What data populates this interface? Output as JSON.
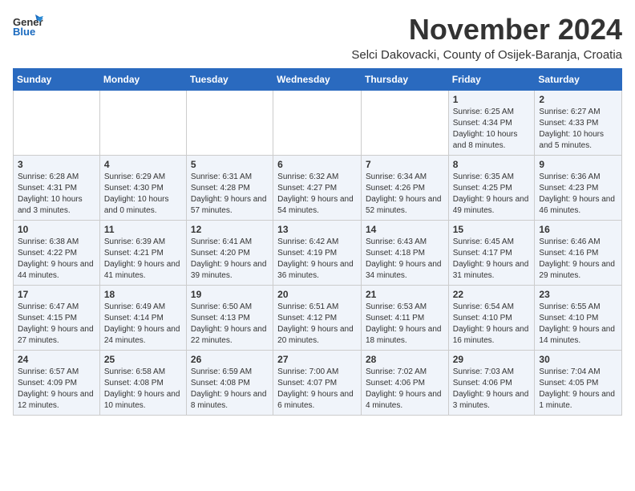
{
  "header": {
    "logo_general": "General",
    "logo_blue": "Blue",
    "month_title": "November 2024",
    "subtitle": "Selci Dakovacki, County of Osijek-Baranja, Croatia"
  },
  "weekdays": [
    "Sunday",
    "Monday",
    "Tuesday",
    "Wednesday",
    "Thursday",
    "Friday",
    "Saturday"
  ],
  "weeks": [
    [
      {
        "day": "",
        "info": ""
      },
      {
        "day": "",
        "info": ""
      },
      {
        "day": "",
        "info": ""
      },
      {
        "day": "",
        "info": ""
      },
      {
        "day": "",
        "info": ""
      },
      {
        "day": "1",
        "info": "Sunrise: 6:25 AM\nSunset: 4:34 PM\nDaylight: 10 hours and 8 minutes."
      },
      {
        "day": "2",
        "info": "Sunrise: 6:27 AM\nSunset: 4:33 PM\nDaylight: 10 hours and 5 minutes."
      }
    ],
    [
      {
        "day": "3",
        "info": "Sunrise: 6:28 AM\nSunset: 4:31 PM\nDaylight: 10 hours and 3 minutes."
      },
      {
        "day": "4",
        "info": "Sunrise: 6:29 AM\nSunset: 4:30 PM\nDaylight: 10 hours and 0 minutes."
      },
      {
        "day": "5",
        "info": "Sunrise: 6:31 AM\nSunset: 4:28 PM\nDaylight: 9 hours and 57 minutes."
      },
      {
        "day": "6",
        "info": "Sunrise: 6:32 AM\nSunset: 4:27 PM\nDaylight: 9 hours and 54 minutes."
      },
      {
        "day": "7",
        "info": "Sunrise: 6:34 AM\nSunset: 4:26 PM\nDaylight: 9 hours and 52 minutes."
      },
      {
        "day": "8",
        "info": "Sunrise: 6:35 AM\nSunset: 4:25 PM\nDaylight: 9 hours and 49 minutes."
      },
      {
        "day": "9",
        "info": "Sunrise: 6:36 AM\nSunset: 4:23 PM\nDaylight: 9 hours and 46 minutes."
      }
    ],
    [
      {
        "day": "10",
        "info": "Sunrise: 6:38 AM\nSunset: 4:22 PM\nDaylight: 9 hours and 44 minutes."
      },
      {
        "day": "11",
        "info": "Sunrise: 6:39 AM\nSunset: 4:21 PM\nDaylight: 9 hours and 41 minutes."
      },
      {
        "day": "12",
        "info": "Sunrise: 6:41 AM\nSunset: 4:20 PM\nDaylight: 9 hours and 39 minutes."
      },
      {
        "day": "13",
        "info": "Sunrise: 6:42 AM\nSunset: 4:19 PM\nDaylight: 9 hours and 36 minutes."
      },
      {
        "day": "14",
        "info": "Sunrise: 6:43 AM\nSunset: 4:18 PM\nDaylight: 9 hours and 34 minutes."
      },
      {
        "day": "15",
        "info": "Sunrise: 6:45 AM\nSunset: 4:17 PM\nDaylight: 9 hours and 31 minutes."
      },
      {
        "day": "16",
        "info": "Sunrise: 6:46 AM\nSunset: 4:16 PM\nDaylight: 9 hours and 29 minutes."
      }
    ],
    [
      {
        "day": "17",
        "info": "Sunrise: 6:47 AM\nSunset: 4:15 PM\nDaylight: 9 hours and 27 minutes."
      },
      {
        "day": "18",
        "info": "Sunrise: 6:49 AM\nSunset: 4:14 PM\nDaylight: 9 hours and 24 minutes."
      },
      {
        "day": "19",
        "info": "Sunrise: 6:50 AM\nSunset: 4:13 PM\nDaylight: 9 hours and 22 minutes."
      },
      {
        "day": "20",
        "info": "Sunrise: 6:51 AM\nSunset: 4:12 PM\nDaylight: 9 hours and 20 minutes."
      },
      {
        "day": "21",
        "info": "Sunrise: 6:53 AM\nSunset: 4:11 PM\nDaylight: 9 hours and 18 minutes."
      },
      {
        "day": "22",
        "info": "Sunrise: 6:54 AM\nSunset: 4:10 PM\nDaylight: 9 hours and 16 minutes."
      },
      {
        "day": "23",
        "info": "Sunrise: 6:55 AM\nSunset: 4:10 PM\nDaylight: 9 hours and 14 minutes."
      }
    ],
    [
      {
        "day": "24",
        "info": "Sunrise: 6:57 AM\nSunset: 4:09 PM\nDaylight: 9 hours and 12 minutes."
      },
      {
        "day": "25",
        "info": "Sunrise: 6:58 AM\nSunset: 4:08 PM\nDaylight: 9 hours and 10 minutes."
      },
      {
        "day": "26",
        "info": "Sunrise: 6:59 AM\nSunset: 4:08 PM\nDaylight: 9 hours and 8 minutes."
      },
      {
        "day": "27",
        "info": "Sunrise: 7:00 AM\nSunset: 4:07 PM\nDaylight: 9 hours and 6 minutes."
      },
      {
        "day": "28",
        "info": "Sunrise: 7:02 AM\nSunset: 4:06 PM\nDaylight: 9 hours and 4 minutes."
      },
      {
        "day": "29",
        "info": "Sunrise: 7:03 AM\nSunset: 4:06 PM\nDaylight: 9 hours and 3 minutes."
      },
      {
        "day": "30",
        "info": "Sunrise: 7:04 AM\nSunset: 4:05 PM\nDaylight: 9 hours and 1 minute."
      }
    ]
  ]
}
